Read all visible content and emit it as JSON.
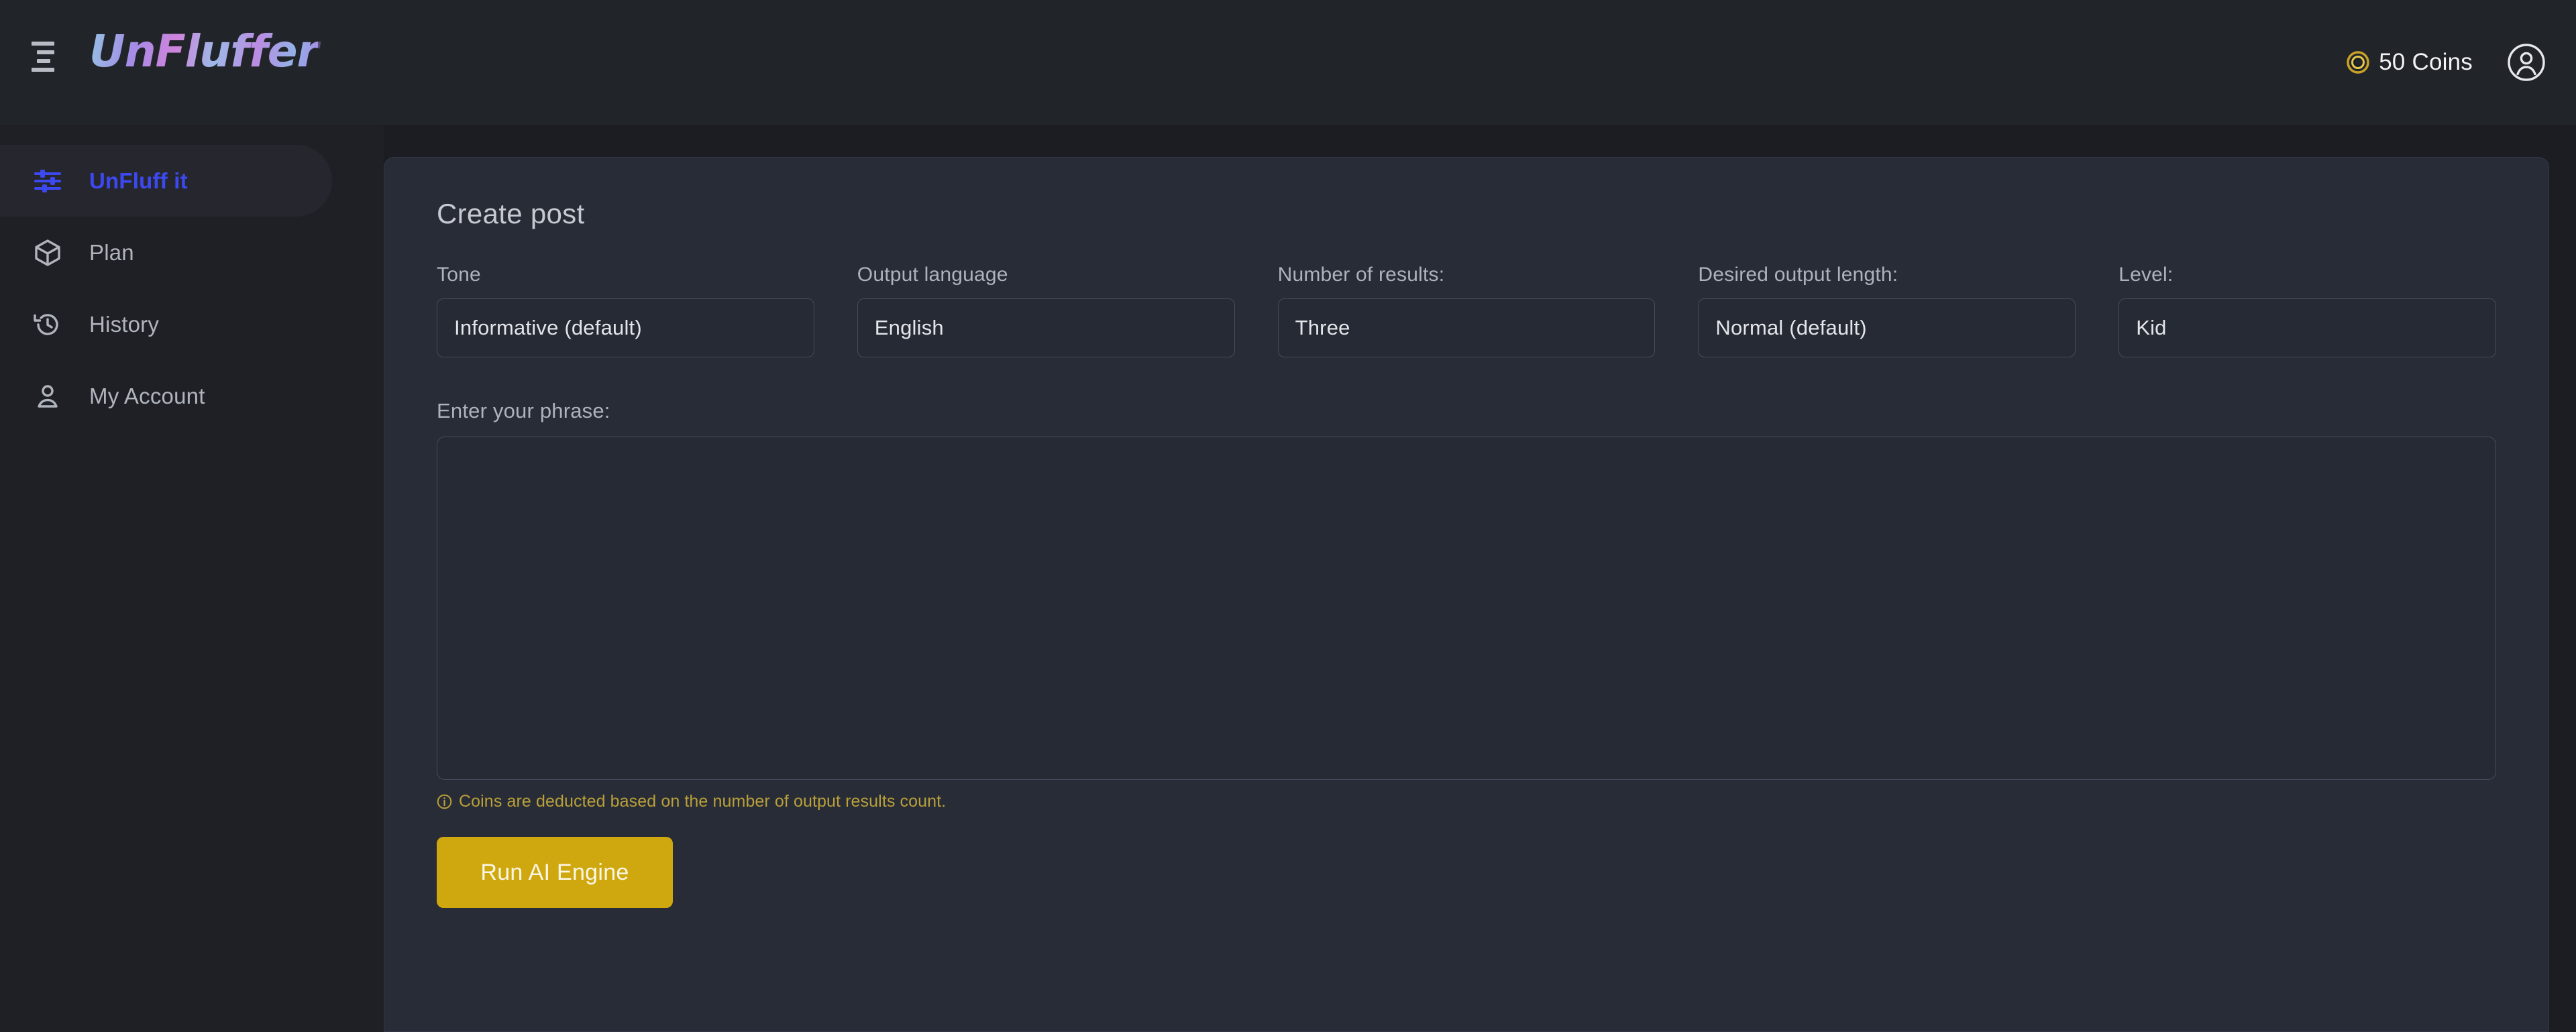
{
  "header": {
    "menu_icon": "hamburger-menu-icon",
    "brand": "UnFluffer",
    "coins_icon": "coin-icon",
    "coins_label": "50 Coins",
    "avatar_icon": "user-avatar-icon"
  },
  "sidebar": {
    "items": [
      {
        "label": "UnFluff it",
        "icon": "sliders-icon",
        "active": true
      },
      {
        "label": "Plan",
        "icon": "cube-icon",
        "active": false
      },
      {
        "label": "History",
        "icon": "history-clock-icon",
        "active": false
      },
      {
        "label": "My Account",
        "icon": "person-icon",
        "active": false
      }
    ]
  },
  "main": {
    "card_title": "Create post",
    "fields": [
      {
        "label": "Tone",
        "value": "Informative (default)"
      },
      {
        "label": "Output language",
        "value": "English"
      },
      {
        "label": "Number of results:",
        "value": "Three"
      },
      {
        "label": "Desired output length:",
        "value": "Normal (default)"
      },
      {
        "label": "Level:",
        "value": "Kid"
      }
    ],
    "phrase_label": "Enter your phrase:",
    "phrase_value": "",
    "phrase_placeholder": "",
    "hint_icon": "info-circle-icon",
    "hint_text": "Coins are deducted based on the number of output results count.",
    "run_button": "Run AI Engine"
  },
  "colors": {
    "page_bg": "#1b1d22",
    "header_bg": "#212429",
    "sidebar_bg": "#1e2025",
    "card_bg": "#282c36",
    "field_bg": "#262a34",
    "field_border": "#454b5d",
    "accent_blue": "#3c48f0",
    "accent_gold": "#cfa80f",
    "hint_gold": "#b9a03a"
  }
}
